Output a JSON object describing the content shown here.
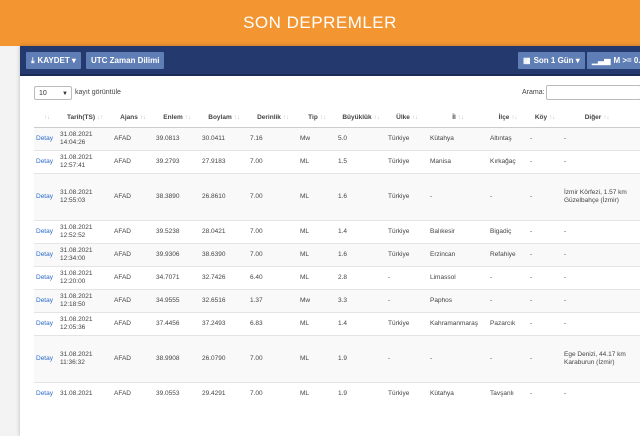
{
  "banner": {
    "title": "SON DEPREMLER"
  },
  "toolbar": {
    "save_label": "KAYDET",
    "utc_label": "UTC Zaman Dilimi",
    "period_label": "Son 1 Gün",
    "magnitude_label": "M >= 0.0"
  },
  "controls": {
    "length_value": "10",
    "length_suffix": "kayıt görüntüle",
    "search_label": "Arama:",
    "search_value": ""
  },
  "table": {
    "columns": [
      "",
      "Tarih(TS)",
      "Ajans",
      "Enlem",
      "Boylam",
      "Derinlik",
      "Tip",
      "Büyüklük",
      "Ülke",
      "İl",
      "İlçe",
      "Köy",
      "Diğer"
    ],
    "rows": [
      {
        "link": "Detay",
        "date": "31.08.2021",
        "time": "14:04:26",
        "agency": "AFAD",
        "lat": "39.0813",
        "lon": "30.0411",
        "depth": "7.16",
        "type": "Mw",
        "mag": "5.0",
        "country": "Türkiye",
        "province": "Kütahya",
        "district": "Altıntaş",
        "village": "-",
        "other": "-",
        "tall": false
      },
      {
        "link": "Detay",
        "date": "31.08.2021",
        "time": "12:57:41",
        "agency": "AFAD",
        "lat": "39.2793",
        "lon": "27.9183",
        "depth": "7.00",
        "type": "ML",
        "mag": "1.5",
        "country": "Türkiye",
        "province": "Manisa",
        "district": "Kırkağaç",
        "village": "-",
        "other": "-",
        "tall": false
      },
      {
        "link": "Detay",
        "date": "31.08.2021",
        "time": "12:55:03",
        "agency": "AFAD",
        "lat": "38.3890",
        "lon": "26.8610",
        "depth": "7.00",
        "type": "ML",
        "mag": "1.6",
        "country": "Türkiye",
        "province": "-",
        "district": "-",
        "village": "-",
        "other": "İzmir Körfezi, 1.57 km Güzelbahçe (İzmir)",
        "tall": true
      },
      {
        "link": "Detay",
        "date": "31.08.2021",
        "time": "12:52:52",
        "agency": "AFAD",
        "lat": "39.5238",
        "lon": "28.0421",
        "depth": "7.00",
        "type": "ML",
        "mag": "1.4",
        "country": "Türkiye",
        "province": "Balıkesir",
        "district": "Bigadiç",
        "village": "-",
        "other": "-",
        "tall": false
      },
      {
        "link": "Detay",
        "date": "31.08.2021",
        "time": "12:34:00",
        "agency": "AFAD",
        "lat": "39.9306",
        "lon": "38.6390",
        "depth": "7.00",
        "type": "ML",
        "mag": "1.6",
        "country": "Türkiye",
        "province": "Erzincan",
        "district": "Refahiye",
        "village": "-",
        "other": "-",
        "tall": false
      },
      {
        "link": "Detay",
        "date": "31.08.2021",
        "time": "12:20:00",
        "agency": "AFAD",
        "lat": "34.7071",
        "lon": "32.7426",
        "depth": "6.40",
        "type": "ML",
        "mag": "2.8",
        "country": "-",
        "province": "Limassol",
        "district": "-",
        "village": "-",
        "other": "-",
        "tall": false
      },
      {
        "link": "Detay",
        "date": "31.08.2021",
        "time": "12:18:50",
        "agency": "AFAD",
        "lat": "34.9555",
        "lon": "32.6516",
        "depth": "1.37",
        "type": "Mw",
        "mag": "3.3",
        "country": "-",
        "province": "Paphos",
        "district": "-",
        "village": "-",
        "other": "-",
        "tall": false
      },
      {
        "link": "Detay",
        "date": "31.08.2021",
        "time": "12:05:36",
        "agency": "AFAD",
        "lat": "37.4456",
        "lon": "37.2493",
        "depth": "6.83",
        "type": "ML",
        "mag": "1.4",
        "country": "Türkiye",
        "province": "Kahramanmaraş",
        "district": "Pazarcık",
        "village": "-",
        "other": "-",
        "tall": false
      },
      {
        "link": "Detay",
        "date": "31.08.2021",
        "time": "11:36:32",
        "agency": "AFAD",
        "lat": "38.9908",
        "lon": "26.0790",
        "depth": "7.00",
        "type": "ML",
        "mag": "1.9",
        "country": "-",
        "province": "-",
        "district": "-",
        "village": "-",
        "other": "Ege Denizi, 44.17 km Karaburun (İzmir)",
        "tall": true
      },
      {
        "link": "Detay",
        "date": "31.08.2021",
        "time": "",
        "agency": "AFAD",
        "lat": "39.0553",
        "lon": "29.4291",
        "depth": "7.00",
        "type": "ML",
        "mag": "1.9",
        "country": "Türkiye",
        "province": "Kütahya",
        "district": "Tavşanlı",
        "village": "-",
        "other": "-",
        "tall": false
      }
    ]
  },
  "colors": {
    "banner": "#f39632",
    "toolbar": "#243a6e",
    "button": "#5f7eb5",
    "link": "#2a6ac9"
  }
}
